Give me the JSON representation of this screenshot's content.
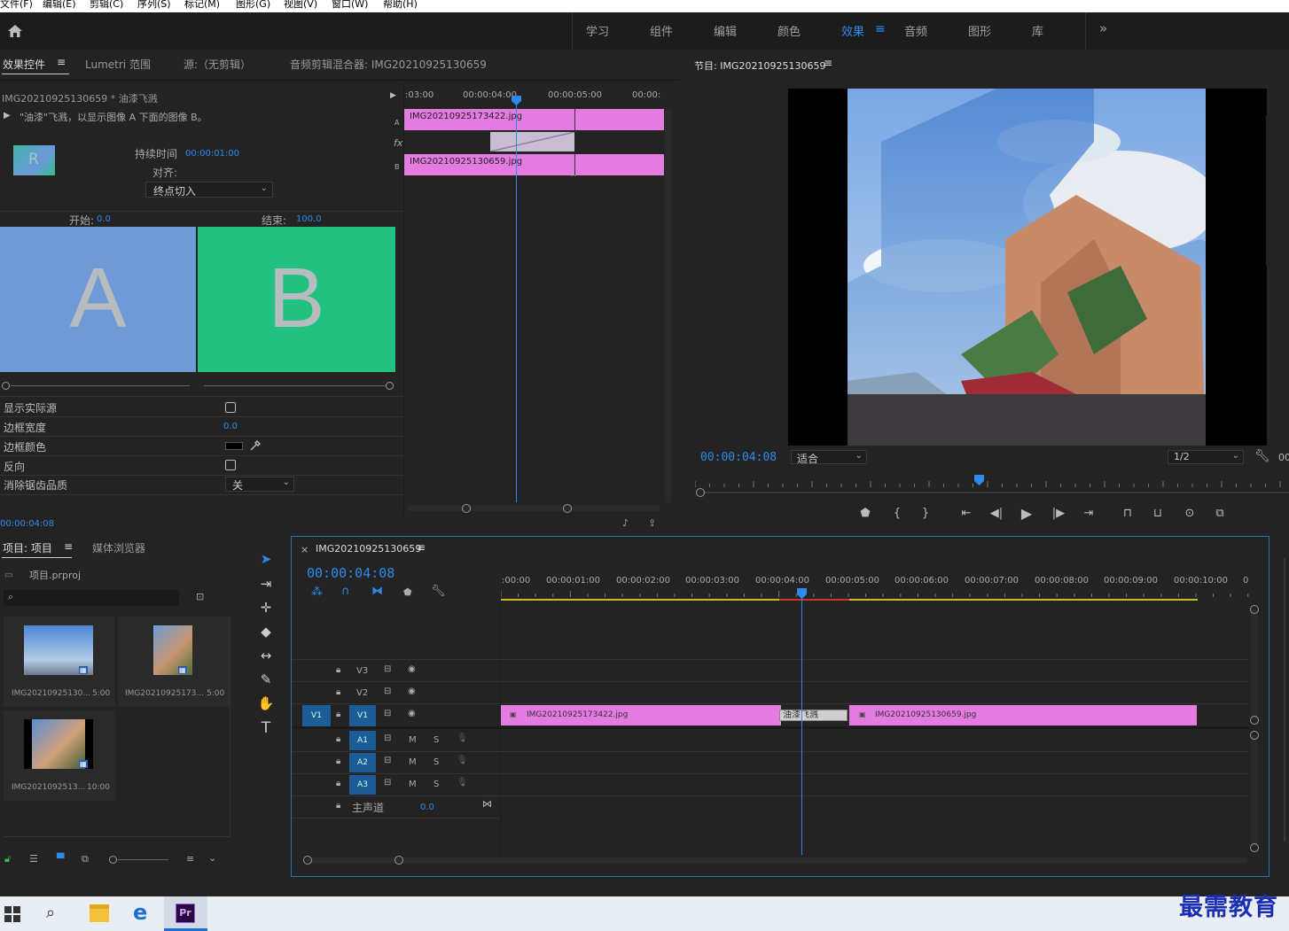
{
  "menu": [
    "文件(F)",
    "编辑(E)",
    "剪辑(C)",
    "序列(S)",
    "标记(M)",
    "图形(G)",
    "视图(V)",
    "窗口(W)",
    "帮助(H)"
  ],
  "workspaces": [
    "学习",
    "组件",
    "编辑",
    "颜色",
    "效果",
    "音频",
    "图形",
    "库"
  ],
  "active_workspace": "效果",
  "effect_panel": {
    "tabs": [
      "效果控件",
      "Lumetri 范围",
      "源:（无剪辑）",
      "音频剪辑混合器: IMG20210925130659"
    ],
    "clip_title": "IMG20210925130659 * 油漆飞溅",
    "description": "\"油漆\"飞溅，以显示图像 A 下面的图像 B。",
    "duration_label": "持续时间",
    "duration_value": "00:00:01:00",
    "align_label": "对齐:",
    "align_value": "终点切入",
    "start_label": "开始:",
    "start_value": "0.0",
    "end_label": "结束:",
    "end_value": "100.0",
    "preview_a": "A",
    "preview_b": "B",
    "props": [
      {
        "label": "显示实际源"
      },
      {
        "label": "边框宽度",
        "value": "0.0"
      },
      {
        "label": "边框颜色"
      },
      {
        "label": "反向"
      },
      {
        "label": "消除锯齿品质",
        "value": "关"
      }
    ],
    "timecode": "00:00:04:08",
    "ruler": [
      ":03:00",
      "00:00:04:00",
      "00:00:05:00",
      "00:00:"
    ],
    "clip_a": "IMG20210925173422.jpg",
    "clip_b": "IMG20210925130659.jpg",
    "track_a": "A",
    "track_fx": "fx",
    "track_b": "B"
  },
  "program": {
    "title": "节目: IMG20210925130659",
    "timecode": "00:00:04:08",
    "fit": "适合",
    "res": "1/2",
    "extra": "00"
  },
  "project": {
    "tabs": [
      "项目: 项目",
      "媒体浏览器"
    ],
    "file": "项目.prproj",
    "items": [
      {
        "name": "IMG20210925130...",
        "dur": "5:00"
      },
      {
        "name": "IMG20210925173...",
        "dur": "5:00"
      },
      {
        "name": "IMG2021092513...",
        "dur": "10:00"
      }
    ]
  },
  "timeline": {
    "tab": "IMG20210925130659",
    "timecode": "00:00:04:08",
    "ruler": [
      ":00:00",
      "00:00:01:00",
      "00:00:02:00",
      "00:00:03:00",
      "00:00:04:00",
      "00:00:05:00",
      "00:00:06:00",
      "00:00:07:00",
      "00:00:08:00",
      "00:00:09:00",
      "00:00:10:00",
      "0"
    ],
    "video_tracks": [
      "V3",
      "V2",
      "V1"
    ],
    "audio_tracks": [
      "A1",
      "A2",
      "A3"
    ],
    "source_patch": "V1",
    "m_label": "M",
    "s_label": "S",
    "master_label": "主声道",
    "master_value": "0.0",
    "clip1": "IMG20210925173422.jpg",
    "transition": "油漆飞溅",
    "clip2": "IMG20210925130659.jpg"
  },
  "watermark": "最需教育",
  "colors": {
    "accent": "#2d8ceb",
    "clip": "#e37be0",
    "a_bg": "#6f9ad6",
    "b_bg": "#22c17f"
  }
}
